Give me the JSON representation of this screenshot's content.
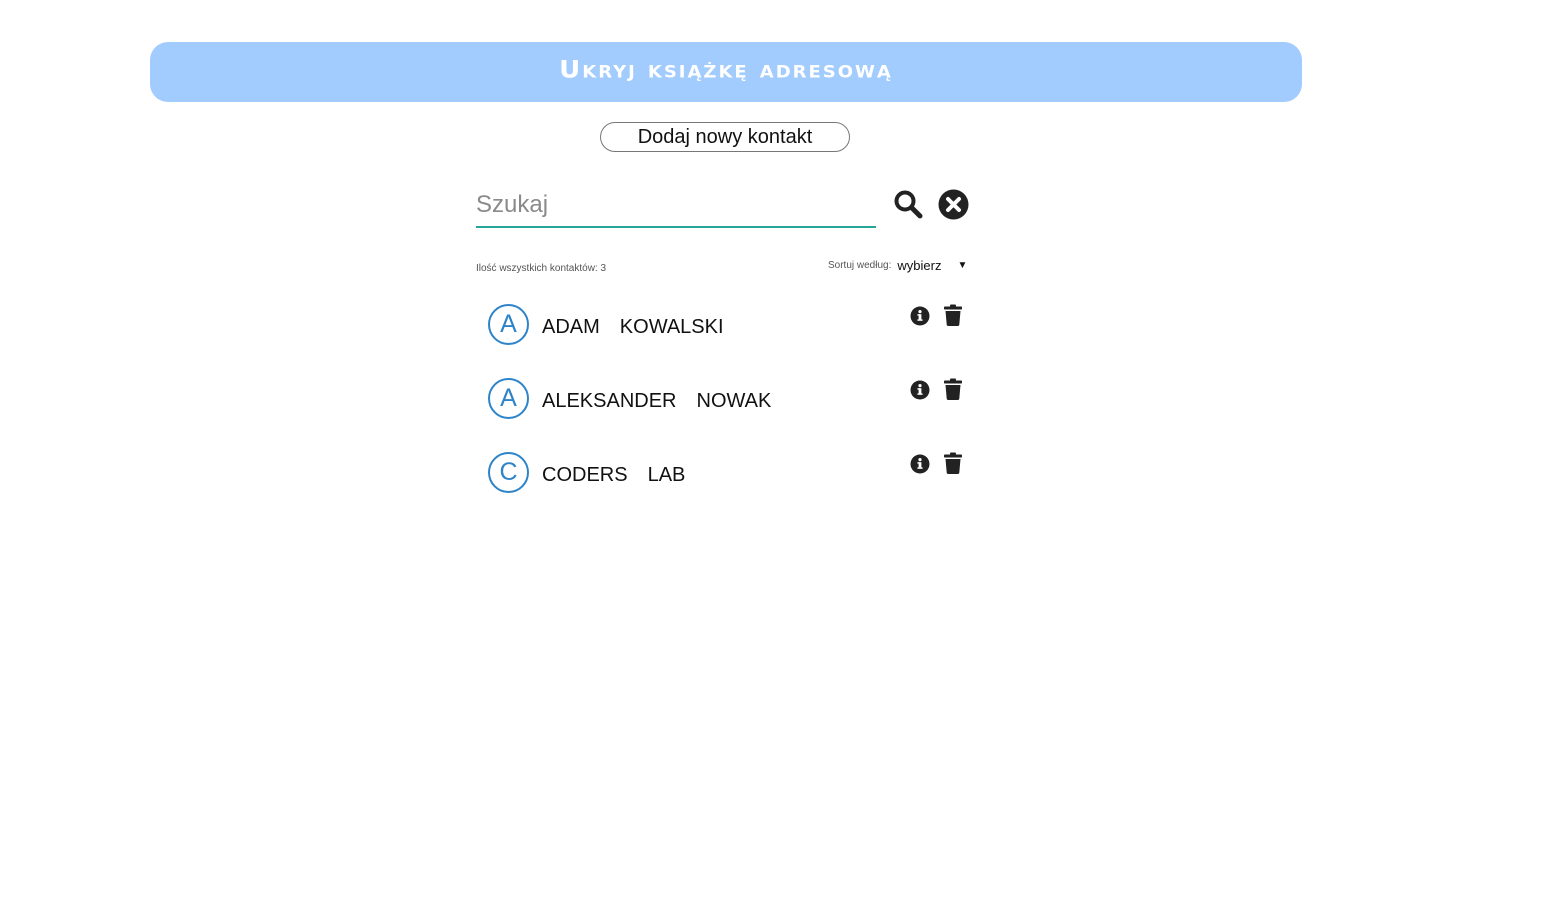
{
  "header": {
    "toggle_label": "Ukryj książkę adresową"
  },
  "actions": {
    "add_contact_label": "Dodaj nowy kontakt"
  },
  "search": {
    "placeholder": "Szukaj",
    "value": "",
    "search_icon": "search-icon",
    "clear_icon": "close-circle-icon",
    "underline_color": "#26a69a"
  },
  "summary": {
    "count_label": "Ilość wszystkich kontaktów: 3"
  },
  "sort": {
    "label": "Sortuj według:",
    "selected": "wybierz"
  },
  "contacts": [
    {
      "initial": "A",
      "first_name": "ADAM",
      "last_name": "KOWALSKI"
    },
    {
      "initial": "A",
      "first_name": "ALEKSANDER",
      "last_name": "NOWAK"
    },
    {
      "initial": "C",
      "first_name": "CODERS",
      "last_name": "LAB"
    }
  ],
  "colors": {
    "header_bg": "#a2ccfd",
    "avatar": "#2d84c9",
    "icons": "#222222"
  }
}
